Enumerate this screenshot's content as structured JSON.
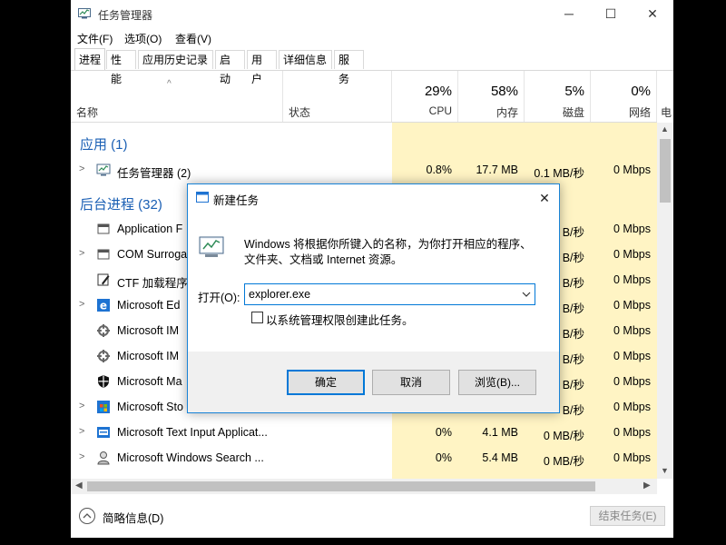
{
  "window": {
    "title": "任务管理器",
    "minimize": "─",
    "maximize": "☐",
    "close": "✕"
  },
  "menu": [
    "文件(F)",
    "选项(O)",
    "查看(V)"
  ],
  "tabs": [
    "进程",
    "性能",
    "应用历史记录",
    "启动",
    "用户",
    "详细信息",
    "服务"
  ],
  "columns": {
    "name": "名称",
    "status": "状态",
    "cpu": {
      "pct": "29%",
      "label": "CPU"
    },
    "memory": {
      "pct": "58%",
      "label": "内存"
    },
    "disk": {
      "pct": "5%",
      "label": "磁盘"
    },
    "network": {
      "pct": "0%",
      "label": "网络"
    },
    "power_partial": "电"
  },
  "groups": {
    "apps": "应用 (1)",
    "background": "后台进程 (32)"
  },
  "app_row": {
    "name": "任务管理器 (2)",
    "cpu": "0.8%",
    "memory": "17.7 MB",
    "disk": "0.1 MB/秒",
    "network": "0 Mbps"
  },
  "bg_rows": [
    {
      "name": "Application F",
      "cpu": "",
      "memory": "",
      "disk": "B/秒",
      "network": "0 Mbps",
      "icon": "app-frame-icon",
      "expand": false
    },
    {
      "name": "COM Surroga",
      "cpu": "",
      "memory": "",
      "disk": "B/秒",
      "network": "0 Mbps",
      "icon": "app-frame-icon",
      "expand": true
    },
    {
      "name": "CTF 加载程序",
      "cpu": "",
      "memory": "",
      "disk": "B/秒",
      "network": "0 Mbps",
      "icon": "pen-icon",
      "expand": false
    },
    {
      "name": "Microsoft Ed",
      "cpu": "",
      "memory": "",
      "disk": "B/秒",
      "network": "0 Mbps",
      "icon": "edge-icon",
      "expand": true
    },
    {
      "name": "Microsoft IM",
      "cpu": "",
      "memory": "",
      "disk": "B/秒",
      "network": "0 Mbps",
      "icon": "gear-icon",
      "expand": false
    },
    {
      "name": "Microsoft IM",
      "cpu": "",
      "memory": "",
      "disk": "B/秒",
      "network": "0 Mbps",
      "icon": "gear-icon",
      "expand": false
    },
    {
      "name": "Microsoft Ma",
      "cpu": "",
      "memory": "",
      "disk": "B/秒",
      "network": "0 Mbps",
      "icon": "shield-icon",
      "expand": false
    },
    {
      "name": "Microsoft Sto",
      "cpu": "",
      "memory": "",
      "disk": "B/秒",
      "network": "0 Mbps",
      "icon": "store-icon",
      "expand": true
    },
    {
      "name": "Microsoft Text Input Applicat...",
      "cpu": "0%",
      "memory": "4.1 MB",
      "disk": "0 MB/秒",
      "network": "0 Mbps",
      "icon": "text-input-icon",
      "expand": true
    },
    {
      "name": "Microsoft Windows Search ...",
      "cpu": "0%",
      "memory": "5.4 MB",
      "disk": "0 MB/秒",
      "network": "0 Mbps",
      "icon": "search-person-icon",
      "expand": true
    }
  ],
  "footer": {
    "fewer_details": "简略信息(D)",
    "end_task": "结束任务(E)"
  },
  "dialog": {
    "title": "新建任务",
    "close": "✕",
    "description_line1": "Windows 将根据你所键入的名称，为你打开相应的程序、",
    "description_line2": "文件夹、文档或 Internet 资源。",
    "open_label": "打开(O):",
    "open_value": "explorer.exe",
    "admin_checkbox": "以系统管理权限创建此任务。",
    "ok": "确定",
    "cancel": "取消",
    "browse": "浏览(B)..."
  },
  "colors": {
    "accent": "#0078d7",
    "group_text": "#1a5fb4",
    "heat_light": "#fff4c4",
    "heat_mid": "#fff0b3"
  }
}
